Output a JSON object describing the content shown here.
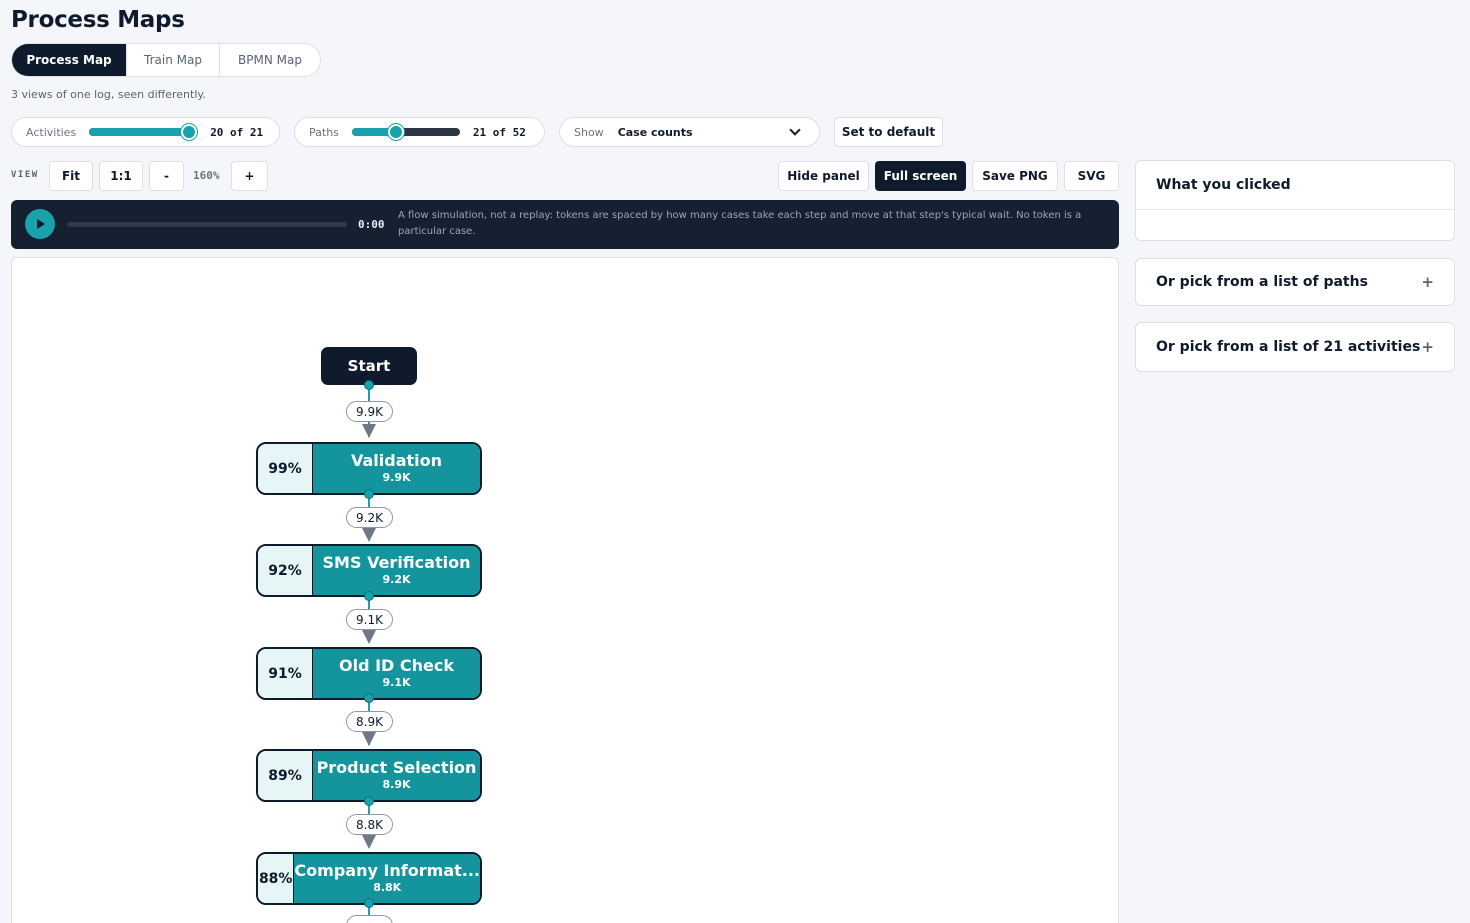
{
  "page": {
    "title": "Process Maps",
    "subtitle": "3 views of one log, seen differently."
  },
  "tabs": [
    {
      "label": "Process Map",
      "active": true
    },
    {
      "label": "Train Map",
      "active": false
    },
    {
      "label": "BPMN Map",
      "active": false
    }
  ],
  "filters": {
    "activities": {
      "label": "Activities",
      "value_text": "20 of 21",
      "value": 20,
      "max": 21
    },
    "paths": {
      "label": "Paths",
      "value_text": "21 of 52",
      "value": 21,
      "max": 52
    },
    "show": {
      "label": "Show",
      "selected": "Case counts"
    },
    "reset_label": "Set to default"
  },
  "view": {
    "label": "VIEW",
    "fit_label": "Fit",
    "one_to_one_label": "1:1",
    "zoom_out_label": "-",
    "zoom_in_label": "+",
    "zoom_text": "160%"
  },
  "toolbar": {
    "hide_panel_label": "Hide panel",
    "full_screen_label": "Full screen",
    "save_png_label": "Save PNG",
    "svg_label": "SVG"
  },
  "player": {
    "time": "0:00",
    "note": "A flow simulation, not a replay: tokens are spaced by how many cases take each step and move at that step's typical wait. No token is a particular case."
  },
  "map": {
    "start_label": "Start",
    "edges": [
      "9.9K",
      "9.2K",
      "9.1K",
      "8.9K",
      "8.8K"
    ],
    "activities": [
      {
        "pct": "99%",
        "name": "Validation",
        "count": "9.9K"
      },
      {
        "pct": "92%",
        "name": "SMS Verification",
        "count": "9.2K"
      },
      {
        "pct": "91%",
        "name": "Old ID Check",
        "count": "9.1K"
      },
      {
        "pct": "89%",
        "name": "Product Selection",
        "count": "8.9K"
      },
      {
        "pct": "88%",
        "name": "Company Informat...",
        "count": "8.8K"
      }
    ]
  },
  "side_panel": {
    "clicked_title": "What you clicked",
    "paths_title": "Or pick from a list of paths",
    "activities_title": "Or pick from a list of 21 activities",
    "expand_icon": "+"
  },
  "colors": {
    "dark": "#0f1b2d",
    "accent": "#19a2ac",
    "node_fill": "#14959e"
  }
}
